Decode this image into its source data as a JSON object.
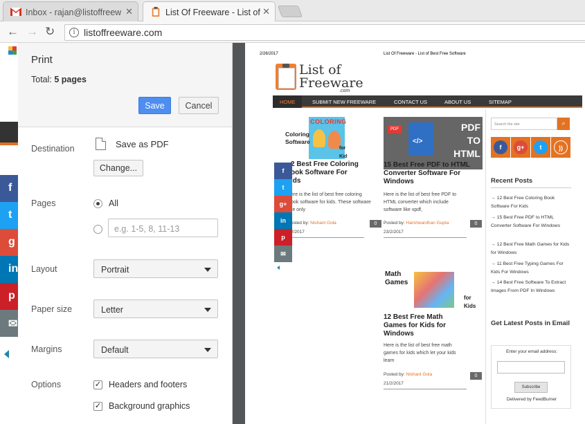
{
  "browser": {
    "tabs": [
      {
        "title": "Inbox - rajan@listoffreew",
        "icon": "gmail-icon"
      },
      {
        "title": "List Of Freeware - List of",
        "icon": "clipboard-icon"
      }
    ],
    "url": "listoffreeware.com"
  },
  "print": {
    "title": "Print",
    "total_label": "Total:",
    "total_value": "5 pages",
    "save_label": "Save",
    "cancel_label": "Cancel",
    "destination_label": "Destination",
    "destination_value": "Save as PDF",
    "change_label": "Change...",
    "pages_label": "Pages",
    "pages_all": "All",
    "pages_placeholder": "e.g. 1-5, 8, 11-13",
    "layout_label": "Layout",
    "layout_value": "Portrait",
    "paper_label": "Paper size",
    "paper_value": "Letter",
    "margins_label": "Margins",
    "margins_value": "Default",
    "options_label": "Options",
    "opt_headers": "Headers and footers",
    "opt_background": "Background graphics"
  },
  "preview": {
    "date": "2/26/2017",
    "header_title": "List Of Freeware - List of Best Free Software",
    "logo_line1": "List of",
    "logo_line2": "Freeware",
    "logo_dotcom": ".com",
    "nav": [
      "HOME",
      "SUBMIT NEW FREEWARE",
      "CONTACT US",
      "ABOUT US",
      "SITEMAP"
    ],
    "posts": [
      {
        "title": "12 Best Free Coloring Book Software For Kids",
        "title_visible": "2 Best Free Coloring\nook Software For\nids",
        "excerpt": "ere is the list of best free coloring\nook software for kids. These software\nre only",
        "author_prefix": "osted by:",
        "author": "Nishant Gola",
        "date": "2/2017",
        "comments": "0",
        "thumb_text": "Coloring\nSoftware",
        "thumb_banner": "COLORING",
        "thumb_for": "for Kids"
      },
      {
        "title": "15 Best Free PDF to HTML Converter Software For Windows",
        "excerpt": "Here is the list of best free PDF to\nHTML converter which include\nsoftware like xpdf,",
        "author_prefix": "Posted by:",
        "author": "Harshwardhan Gupta",
        "date": "23/2/2017",
        "comments": "0",
        "thumb_text": "PDF TO HTML",
        "thumb_badge": "PDF",
        "thumb_code": "</>"
      },
      {
        "title": "12 Best Free Math Games for Kids for Windows",
        "excerpt": "Here is the list of best free math\ngames for kids which let your kids\nlearn",
        "author_prefix": "Posted by:",
        "author": "Nishant Gola",
        "date": "21/2/2017",
        "comments": "0",
        "thumb_text": "Math Games",
        "thumb_for": "for Kids"
      }
    ],
    "share": [
      "f",
      "t",
      "g+",
      "in",
      "p",
      "✉"
    ],
    "sidebar": {
      "search_placeholder": "Search the site",
      "recent_heading": "Recent Posts",
      "recent": [
        "12 Best Free Coloring Book Software For Kids",
        "15 Best Free PDF to HTML Converter Software For Windows",
        "12 Best Free Math Games for Kids for Windows",
        "11 Best Free Typing Games For Kids For Windows",
        "14 Best Free Software To Extract Images From PDF In Windows"
      ],
      "latest_heading": "Get Latest Posts in Email",
      "email_label": "Enter your email address:",
      "subscribe_label": "Subscribe",
      "delivered": "Delivered by FeedBurner"
    }
  },
  "colors": {
    "accent": "#e37222",
    "save_blue": "#4d8ef0",
    "facebook": "#3b5998",
    "twitter": "#1da1f2",
    "googleplus": "#dd4b39",
    "linkedin": "#0077b5",
    "pinterest": "#cb2027",
    "email": "#6d7a7d"
  }
}
